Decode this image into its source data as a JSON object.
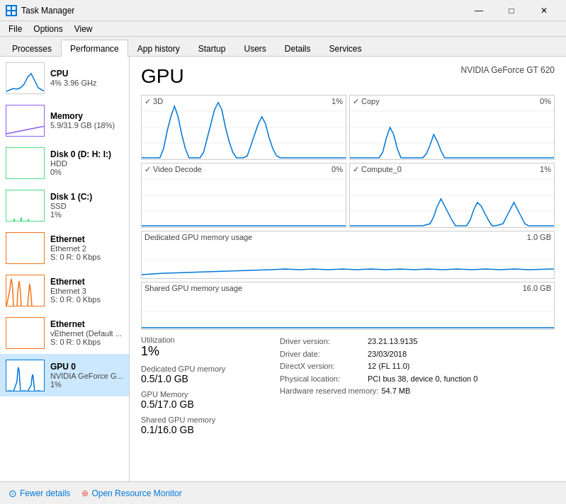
{
  "titlebar": {
    "icon_label": "TM",
    "title": "Task Manager",
    "min_btn": "—",
    "max_btn": "□",
    "close_btn": "✕"
  },
  "menubar": {
    "items": [
      "File",
      "Options",
      "View"
    ]
  },
  "tabs": {
    "items": [
      "Processes",
      "Performance",
      "App history",
      "Startup",
      "Users",
      "Details",
      "Services"
    ],
    "active": 1
  },
  "sidebar": {
    "items": [
      {
        "name": "CPU",
        "sub": "4% 3.96 GHz",
        "val": "",
        "type": "cpu",
        "color": "#0078d7"
      },
      {
        "name": "Memory",
        "sub": "5.9/31.9 GB (18%)",
        "val": "",
        "type": "memory",
        "color": "#8b5cf6"
      },
      {
        "name": "Disk 0 (D: H: I:)",
        "sub": "HDD",
        "val": "0%",
        "type": "disk0",
        "color": "#4ade80"
      },
      {
        "name": "Disk 1 (C:)",
        "sub": "SSD",
        "val": "1%",
        "type": "disk1",
        "color": "#4ade80"
      },
      {
        "name": "Ethernet",
        "sub": "Ethernet 2",
        "val": "S: 0  R: 0 Kbps",
        "type": "eth2",
        "color": "#f97316"
      },
      {
        "name": "Ethernet",
        "sub": "Ethernet 3",
        "val": "S: 0  R: 0 Kbps",
        "type": "eth3",
        "color": "#f97316"
      },
      {
        "name": "Ethernet",
        "sub": "vEthernet (Default ...",
        "val": "S: 0  R: 0 Kbps",
        "type": "ethv",
        "color": "#f97316"
      },
      {
        "name": "GPU 0",
        "sub": "NVIDIA GeForce G...",
        "val": "1%",
        "type": "gpu",
        "color": "#0078d7",
        "active": true
      }
    ]
  },
  "content": {
    "title": "GPU",
    "subtitle": "NVIDIA GeForce GT 620",
    "charts": [
      {
        "label": "3D",
        "percent": "1%",
        "id": "chart3d"
      },
      {
        "label": "Copy",
        "percent": "0%",
        "id": "chartCopy"
      },
      {
        "label": "Video Decode",
        "percent": "0%",
        "id": "chartVD"
      },
      {
        "label": "Compute_0",
        "percent": "1%",
        "id": "chartC0"
      }
    ],
    "memory_charts": [
      {
        "label": "Dedicated GPU memory usage",
        "max": "1.0 GB",
        "id": "chartDed"
      },
      {
        "label": "Shared GPU memory usage",
        "max": "16.0 GB",
        "id": "chartShared"
      }
    ],
    "stats": [
      {
        "label": "Utilization",
        "value": "1%"
      },
      {
        "label": "Dedicated GPU memory",
        "value": "0.5/1.0 GB"
      },
      {
        "label": "GPU Memory",
        "value": "0.5/17.0 GB"
      },
      {
        "label": "Shared GPU memory",
        "value": "0.1/16.0 GB"
      }
    ],
    "driver_info": [
      {
        "key": "Driver version:",
        "value": "23.21.13.9135"
      },
      {
        "key": "Driver date:",
        "value": "23/03/2018"
      },
      {
        "key": "DirectX version:",
        "value": "12 (FL 11.0)"
      },
      {
        "key": "Physical location:",
        "value": "PCI bus 38, device 0, function 0"
      },
      {
        "key": "Hardware reserved memory:",
        "value": "54.7 MB"
      }
    ]
  },
  "bottom": {
    "fewer_details": "Fewer details",
    "open_monitor": "Open Resource Monitor"
  }
}
